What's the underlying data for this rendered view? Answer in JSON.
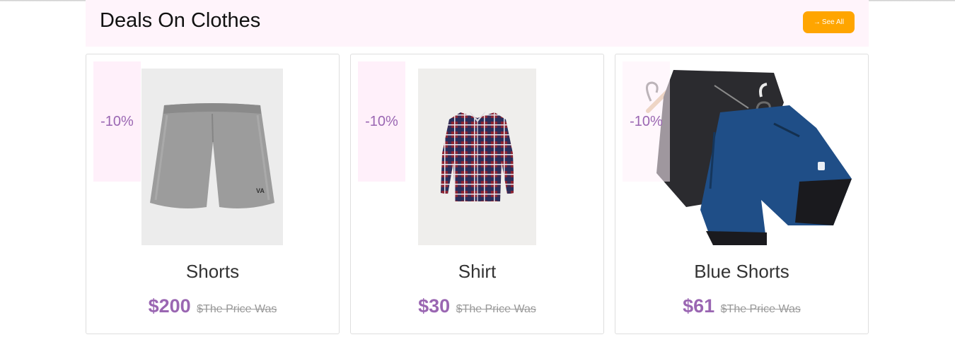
{
  "section": {
    "title": "Deals On Clothes",
    "see_all_label": "See All",
    "see_all_icon": "arrow-right-icon"
  },
  "colors": {
    "accent_purple": "#9a66b2",
    "button_orange": "#ffa500",
    "header_bg": "#fff4fb",
    "badge_bg": "#fff0fa"
  },
  "products": [
    {
      "discount": "-10%",
      "name": "Shorts",
      "price": "$200",
      "was": "$The Price Was",
      "image": "grey-shorts"
    },
    {
      "discount": "-10%",
      "name": "Shirt",
      "price": "$30",
      "was": "$The Price Was",
      "image": "plaid-shirt"
    },
    {
      "discount": "-10%",
      "name": "Blue Shorts",
      "price": "$61",
      "was": "$The Price Was",
      "image": "blue-black-shorts"
    }
  ]
}
